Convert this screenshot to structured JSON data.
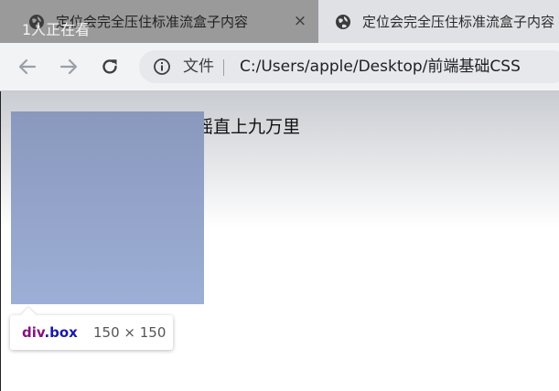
{
  "browser": {
    "tabs": [
      {
        "title": "定位会完全压住标准流盒子内容",
        "active": true
      },
      {
        "title": "定位会完全压住标准流盒子内容",
        "active": false
      }
    ],
    "close_glyph": "×",
    "viewer_count": "1人正在看",
    "address": {
      "info_label": "文件",
      "url": "C:/Users/apple/Desktop/前端基础CSS"
    },
    "icons": {
      "tab": "globe-icon",
      "back": "back-arrow-icon",
      "forward": "forward-arrow-icon",
      "reload": "reload-icon",
      "info": "info-icon"
    }
  },
  "page": {
    "text": "摇直上九万里",
    "box_color": "#9aa9cf",
    "tooltip": {
      "tag": "div",
      "class_name": ".box",
      "size": "150 × 150"
    }
  }
}
